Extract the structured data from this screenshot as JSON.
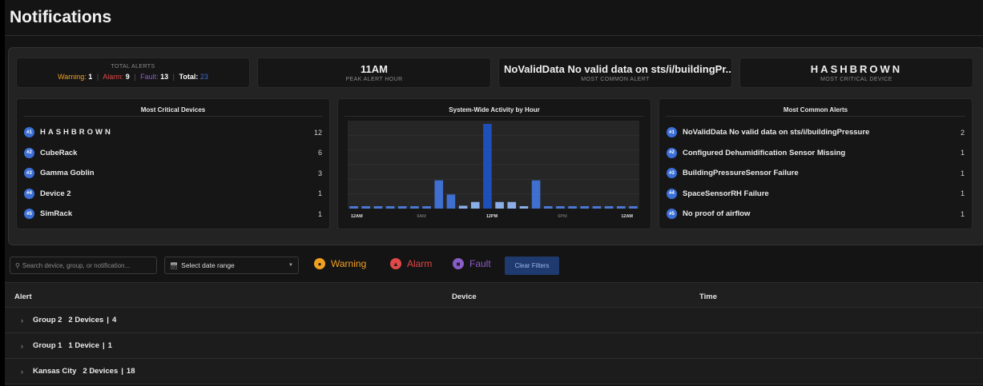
{
  "page": {
    "title": "Notifications"
  },
  "kpis": {
    "total": {
      "heading": "TOTAL ALERTS",
      "warning_label": "Warning:",
      "warning_count": "1",
      "alarm_label": "Alarm:",
      "alarm_count": "9",
      "fault_label": "Fault:",
      "fault_count": "13",
      "total_label": "Total:",
      "total_count": "23",
      "sep": "|"
    },
    "peak": {
      "value": "11AM",
      "label": "PEAK ALERT HOUR"
    },
    "common": {
      "value": "NoValidData No valid data on sts/i/buildingPr...",
      "label": "MOST COMMON ALERT"
    },
    "critical": {
      "value": "HASHBROWN",
      "label": "MOST CRITICAL DEVICE"
    }
  },
  "devices_card": {
    "title": "Most Critical Devices",
    "items": [
      {
        "rank": "#1",
        "name": "HASHBROWN",
        "count": "12"
      },
      {
        "rank": "#2",
        "name": "CubeRack",
        "count": "6"
      },
      {
        "rank": "#3",
        "name": "Gamma Goblin",
        "count": "3"
      },
      {
        "rank": "#4",
        "name": "Device 2",
        "count": "1"
      },
      {
        "rank": "#5",
        "name": "SimRack",
        "count": "1"
      }
    ]
  },
  "chart_card": {
    "title": "System-Wide Activity by Hour"
  },
  "chart_data": {
    "type": "bar",
    "title": "System-Wide Activity by Hour",
    "categories": [
      "12AM",
      "1AM",
      "2AM",
      "3AM",
      "4AM",
      "5AM",
      "6AM",
      "7AM",
      "8AM",
      "9AM",
      "10AM",
      "11AM",
      "12PM",
      "1PM",
      "2PM",
      "3PM",
      "4PM",
      "5PM",
      "6PM",
      "7PM",
      "8PM",
      "9PM",
      "10PM",
      "11PM"
    ],
    "values": [
      0,
      0,
      0,
      0,
      0,
      0,
      0,
      3,
      1.5,
      0.3,
      0.7,
      9,
      0.7,
      0.7,
      0.2,
      3,
      0,
      0,
      0,
      0,
      0,
      0,
      0,
      0
    ],
    "tick_labels": [
      "12AM",
      "6AM",
      "12PM",
      "6PM",
      "12AM"
    ],
    "ylim": [
      0,
      9
    ],
    "grid": true,
    "colors": {
      "normal": "#3f6fcf",
      "highlight": "#1f4fb8",
      "baseline": "#4a78d4",
      "light": "#8aaee8"
    }
  },
  "alerts_card": {
    "title": "Most Common Alerts",
    "items": [
      {
        "rank": "#1",
        "name": "NoValidData No valid data on sts/i/buildingPressure",
        "count": "2"
      },
      {
        "rank": "#2",
        "name": "Configured Dehumidification Sensor Missing",
        "count": "1"
      },
      {
        "rank": "#3",
        "name": "BuildingPressureSensor Failure",
        "count": "1"
      },
      {
        "rank": "#4",
        "name": "SpaceSensorRH Failure",
        "count": "1"
      },
      {
        "rank": "#5",
        "name": "No proof of airflow",
        "count": "1"
      }
    ]
  },
  "filters": {
    "search_placeholder": "Search device, group, or notification...",
    "date_placeholder": "Select date range",
    "warning": "Warning",
    "alarm": "Alarm",
    "fault": "Fault",
    "clear": "Clear Filters"
  },
  "colors": {
    "warning": "#f0a020",
    "alarm": "#e04848",
    "fault": "#8a5cc8",
    "total": "#3b6fd6",
    "accent": "#3b6fd6"
  },
  "table": {
    "columns": {
      "alert": "Alert",
      "device": "Device",
      "time": "Time"
    },
    "groups": [
      {
        "name": "Group 2",
        "devices": "2 Devices",
        "count": "4"
      },
      {
        "name": "Group 1",
        "devices": "1 Device",
        "count": "1"
      },
      {
        "name": "Kansas City",
        "devices": "2 Devices",
        "count": "18"
      }
    ],
    "sep": "|"
  }
}
